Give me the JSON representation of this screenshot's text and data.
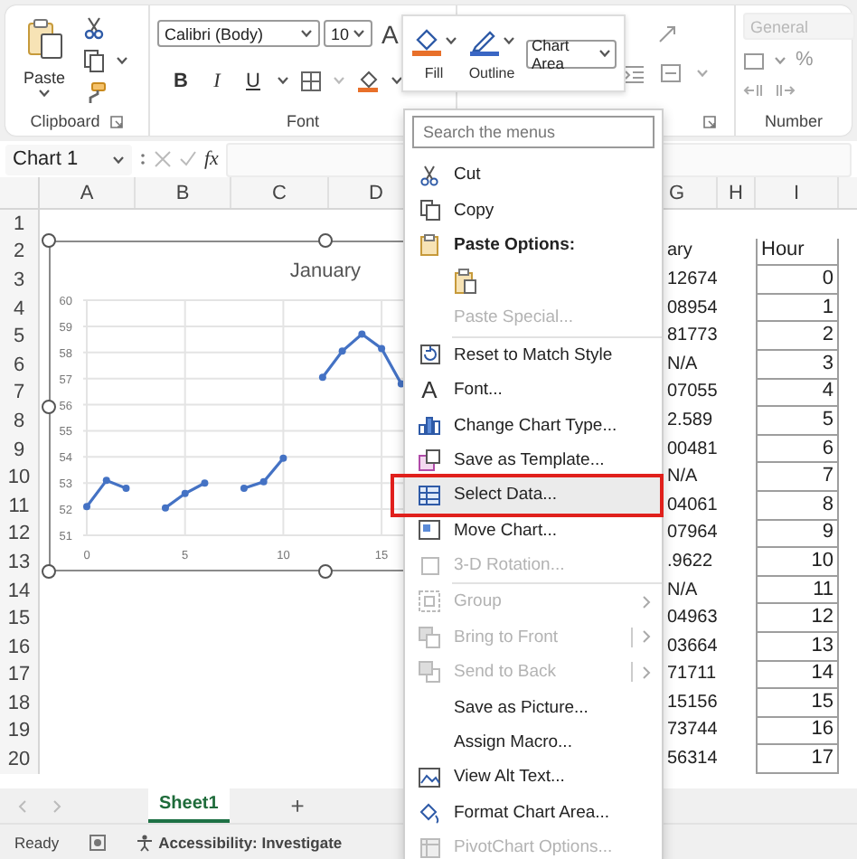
{
  "ribbon": {
    "clipboard": {
      "paste_label": "Paste",
      "group_label": "Clipboard"
    },
    "font": {
      "font_name": "Calibri (Body)",
      "font_size": "10",
      "grow_font": "A",
      "bold": "B",
      "italic": "I",
      "underline": "U",
      "group_label": "Font"
    },
    "number": {
      "format": "General",
      "format_disabled": true,
      "percent": "%",
      "group_label": "Number"
    }
  },
  "mini_toolbar": {
    "fill_label": "Fill",
    "outline_label": "Outline",
    "element": "Chart Area"
  },
  "formula_bar": {
    "name_box": "Chart 1",
    "fx": "fx"
  },
  "grid": {
    "columns": [
      "A",
      "B",
      "C",
      "D",
      "G",
      "H",
      "I"
    ],
    "rows": [
      "1",
      "2",
      "3",
      "4",
      "5",
      "6",
      "7",
      "8",
      "9",
      "10",
      "11",
      "12",
      "13",
      "14",
      "15",
      "16",
      "17",
      "18",
      "19",
      "20"
    ],
    "column_g": [
      "ary",
      "12674",
      "08954",
      "81773",
      "N/A",
      "07055",
      "2.589",
      "00481",
      "N/A",
      "04061",
      "07964",
      ".9622",
      "N/A",
      "04963",
      "03664",
      "71711",
      "15156",
      "73744",
      "56314"
    ],
    "column_i": [
      "Hour",
      "0",
      "1",
      "2",
      "3",
      "4",
      "5",
      "6",
      "7",
      "8",
      "9",
      "10",
      "11",
      "12",
      "13",
      "14",
      "15",
      "16",
      "17"
    ]
  },
  "chart": {
    "chart_data": {
      "type": "line",
      "title": "January",
      "grid": true,
      "x": [
        0,
        1,
        2,
        3,
        4,
        5,
        6,
        7,
        8,
        9,
        10,
        11,
        12,
        13,
        14,
        15,
        16
      ],
      "series": [
        {
          "color": "#4472c4",
          "marker": "circle",
          "values": [
            52.1,
            53.1,
            52.8,
            null,
            52.05,
            52.6,
            53,
            null,
            52.8,
            53.05,
            53.95,
            null,
            57.05,
            58.05,
            58.7,
            58.15,
            56.8
          ]
        }
      ],
      "xlim": [
        0,
        25
      ],
      "ylim": [
        51,
        60
      ],
      "yticks": [
        51,
        52,
        53,
        54,
        55,
        56,
        57,
        58,
        59,
        60
      ],
      "xticks": [
        0,
        5,
        10,
        15
      ]
    }
  },
  "menu": {
    "search": {
      "placeholder": "Search the menus"
    },
    "items": [
      {
        "kind": "item",
        "label": "Cut",
        "disabled": false,
        "highlighted": false,
        "submenu": false
      },
      {
        "kind": "item",
        "label": "Copy",
        "disabled": false,
        "highlighted": false,
        "submenu": false
      },
      {
        "kind": "header",
        "label": "Paste Options:"
      },
      {
        "kind": "paste-icons"
      },
      {
        "kind": "item",
        "label": "Paste Special...",
        "disabled": true,
        "highlighted": false,
        "submenu": false
      },
      {
        "kind": "separator"
      },
      {
        "kind": "item",
        "label": "Reset to Match Style",
        "disabled": false,
        "highlighted": false,
        "submenu": false
      },
      {
        "kind": "item",
        "label": "Font...",
        "glyph": "A",
        "disabled": false,
        "highlighted": false,
        "submenu": false
      },
      {
        "kind": "item",
        "label": "Change Chart Type...",
        "disabled": false,
        "highlighted": false,
        "submenu": false
      },
      {
        "kind": "item",
        "label": "Save as Template...",
        "disabled": false,
        "highlighted": false,
        "submenu": false
      },
      {
        "kind": "item",
        "label": "Select Data...",
        "disabled": false,
        "highlighted": true,
        "submenu": false
      },
      {
        "kind": "item",
        "label": "Move Chart...",
        "disabled": false,
        "highlighted": false,
        "submenu": false
      },
      {
        "kind": "item",
        "label": "3-D Rotation...",
        "disabled": true,
        "highlighted": false,
        "submenu": false
      },
      {
        "kind": "separator"
      },
      {
        "kind": "item",
        "label": "Group",
        "disabled": true,
        "highlighted": false,
        "submenu": true,
        "split": false
      },
      {
        "kind": "item",
        "label": "Bring to Front",
        "disabled": true,
        "highlighted": false,
        "submenu": true,
        "split": true
      },
      {
        "kind": "item",
        "label": "Send to Back",
        "disabled": true,
        "highlighted": false,
        "submenu": true,
        "split": true
      },
      {
        "kind": "item",
        "label": "Save as Picture...",
        "disabled": false,
        "highlighted": false,
        "submenu": false
      },
      {
        "kind": "item",
        "label": "Assign Macro...",
        "disabled": false,
        "highlighted": false,
        "submenu": false
      },
      {
        "kind": "item",
        "label": "View Alt Text...",
        "disabled": false,
        "highlighted": false,
        "submenu": false
      },
      {
        "kind": "item",
        "label": "Format Chart Area...",
        "disabled": false,
        "highlighted": false,
        "submenu": false
      },
      {
        "kind": "item",
        "label": "PivotChart Options...",
        "disabled": true,
        "highlighted": false,
        "submenu": false
      }
    ]
  },
  "tabs": {
    "sheets": [
      {
        "label": "Sheet1",
        "selected": true
      }
    ],
    "add": "+"
  },
  "status_bar": {
    "ready": "Ready",
    "accessibility": "Accessibility: Investigate"
  }
}
